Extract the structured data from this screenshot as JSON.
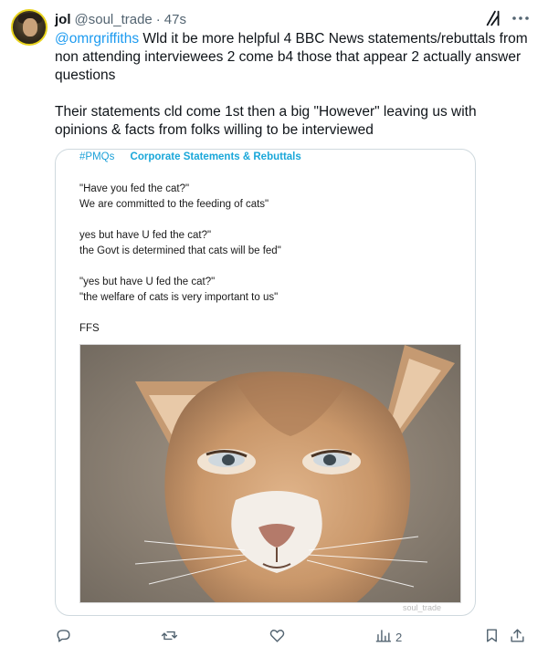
{
  "author": {
    "name": "jol",
    "handle": "@soul_trade",
    "separator": "·",
    "time": "47s"
  },
  "tweet": {
    "mention": "@omrgriffiths",
    "paragraph1": " Wld it be more helpful 4 BBC News statements/rebuttals from non attending interviewees 2 come b4 those that appear 2 actually answer questions",
    "paragraph2": "Their statements cld come 1st then a big \"However\"  leaving us with opinions & facts from folks willing to be interviewed"
  },
  "media": {
    "hashtag": "#PMQs",
    "title": "Corporate Statements & Rebuttals",
    "lines": [
      "\"Have you fed the cat?\"",
      "We are committed to the feeding of cats\"",
      "",
      "yes but have U fed the cat?\"",
      "the Govt is determined that cats will be fed\"",
      "",
      "\"yes but have U fed the cat?\"",
      "\"the welfare of cats is very important to us\"",
      "",
      "FFS"
    ],
    "watermark": "soul_trade"
  },
  "actions": {
    "reply_count": "",
    "repost_count": "",
    "like_count": "",
    "views_count": "2"
  },
  "colors": {
    "accent": "#1d9bf0",
    "text": "#0f1419",
    "muted": "#536471",
    "border": "#cfd9de"
  },
  "icons": [
    "grok-icon",
    "more-icon",
    "reply-icon",
    "repost-icon",
    "like-icon",
    "views-icon",
    "bookmark-icon",
    "share-icon"
  ]
}
